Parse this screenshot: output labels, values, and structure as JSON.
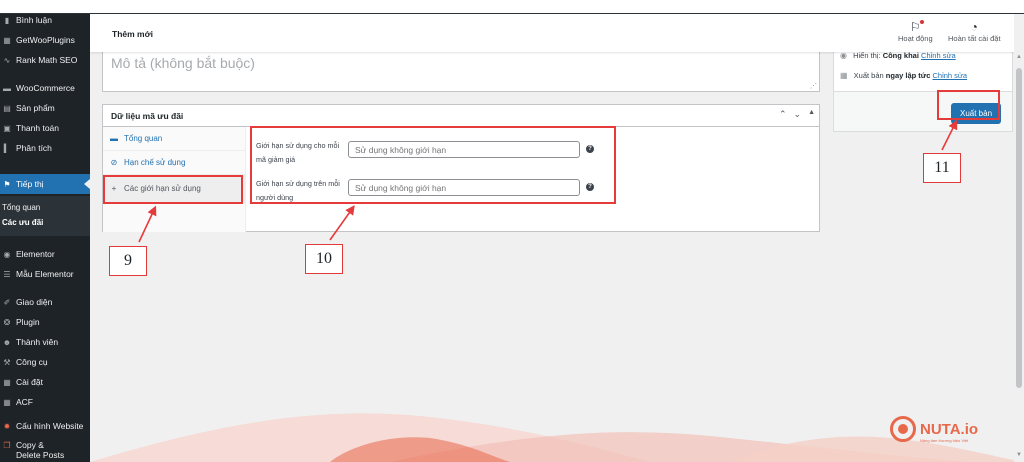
{
  "header": {
    "title": "Thêm mới",
    "activity_label": "Hoạt động",
    "setup_label": "Hoàn tất cài đặt"
  },
  "sidebar": {
    "items": [
      {
        "label": "Bình luận",
        "icon": "comment-icon"
      },
      {
        "label": "GetWooPlugins",
        "icon": "plugin-grid-icon"
      },
      {
        "label": "Rank Math SEO",
        "icon": "rank-math-icon"
      },
      {
        "label": "WooCommerce",
        "icon": "woocommerce-icon"
      },
      {
        "label": "Sản phẩm",
        "icon": "products-icon"
      },
      {
        "label": "Thanh toán",
        "icon": "payment-icon"
      },
      {
        "label": "Phân tích",
        "icon": "analytics-icon"
      },
      {
        "label": "Tiếp thị",
        "icon": "marketing-icon"
      },
      {
        "label": "Elementor",
        "icon": "elementor-icon"
      },
      {
        "label": "Mẫu Elementor",
        "icon": "templates-icon"
      },
      {
        "label": "Giao diện",
        "icon": "appearance-icon"
      },
      {
        "label": "Plugin",
        "icon": "plugin-icon"
      },
      {
        "label": "Thành viên",
        "icon": "users-icon"
      },
      {
        "label": "Công cụ",
        "icon": "tools-icon"
      },
      {
        "label": "Cài đặt",
        "icon": "settings-icon"
      },
      {
        "label": "ACF",
        "icon": "acf-icon"
      },
      {
        "label": "Cấu hình Website",
        "icon": "gear-icon"
      },
      {
        "label": "Copy &",
        "label2": "Delete Posts",
        "icon": "copy-icon"
      }
    ],
    "submenu": [
      "Tổng quan",
      "Các ưu đãi"
    ]
  },
  "description": {
    "placeholder": "Mô tả (không bắt buộc)"
  },
  "publish": {
    "visibility_label": "Hiển thị:",
    "visibility_value": "Công khai",
    "visibility_edit": "Chỉnh sửa",
    "schedule_label": "Xuất bản",
    "schedule_value": "ngay lập tức",
    "schedule_edit": "Chỉnh sửa",
    "button": "Xuất bản"
  },
  "coupon": {
    "title": "Dữ liệu mã ưu đãi",
    "tabs": [
      {
        "label": "Tổng quan",
        "icon": "ticket-icon"
      },
      {
        "label": "Hạn chế sử dụng",
        "icon": "restrict-icon"
      },
      {
        "label": "Các giới hạn sử dụng",
        "icon": "plus-icon"
      }
    ],
    "fields": [
      {
        "label": "Giới hạn sử dụng cho mỗi mã giảm giá",
        "placeholder": "Sử dụng không giới hạn"
      },
      {
        "label": "Giới hạn sử dụng trên mỗi người dùng",
        "placeholder": "Sử dụng không giới hạn"
      }
    ]
  },
  "annotations": {
    "n9": "9",
    "n10": "10",
    "n11": "11",
    "color": "#e63b3b"
  },
  "brand": {
    "logo_text": "NUTA.io",
    "tagline": "Nâng tầm thương hiệu Việt",
    "accent": "#e8684a",
    "wp_blue": "#2271b1",
    "sidebar_bg": "#1d2327"
  }
}
